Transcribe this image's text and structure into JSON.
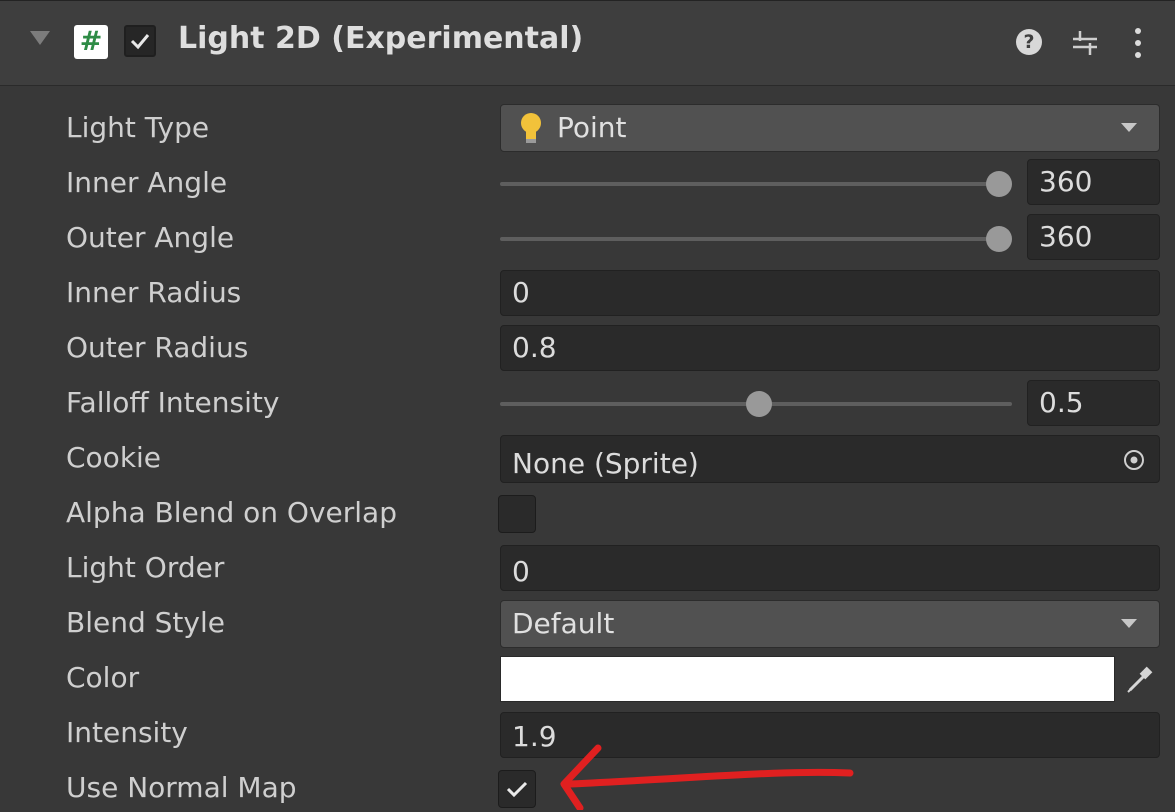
{
  "component": {
    "title": "Light 2D (Experimental)",
    "enabled": true
  },
  "fields": {
    "light_type": {
      "label": "Light Type",
      "value": "Point"
    },
    "inner_angle": {
      "label": "Inner Angle",
      "value": "360",
      "slider_fraction": 1.0
    },
    "outer_angle": {
      "label": "Outer Angle",
      "value": "360",
      "slider_fraction": 1.0
    },
    "inner_radius": {
      "label": "Inner Radius",
      "value": "0"
    },
    "outer_radius": {
      "label": "Outer Radius",
      "value": "0.8"
    },
    "falloff_intensity": {
      "label": "Falloff Intensity",
      "value": "0.5",
      "slider_fraction": 0.5
    },
    "cookie": {
      "label": "Cookie",
      "value": "None (Sprite)"
    },
    "alpha_blend": {
      "label": "Alpha Blend on Overlap",
      "checked": false
    },
    "light_order": {
      "label": "Light Order",
      "value": "0"
    },
    "blend_style": {
      "label": "Blend Style",
      "value": "Default"
    },
    "color": {
      "label": "Color",
      "value": "#FFFFFF"
    },
    "intensity": {
      "label": "Intensity",
      "value": "1.9"
    },
    "use_normal_map": {
      "label": "Use Normal Map",
      "checked": true
    }
  },
  "icons": {
    "foldout": "triangle-down",
    "script": "hash",
    "help": "question-mark",
    "presets": "sliders",
    "menu": "vertical-ellipsis",
    "light_type": "light-bulb",
    "cookie_picker": "object-picker-circle",
    "color_picker": "eyedropper",
    "annotation": "red-arrow"
  },
  "colors": {
    "background": "#383838",
    "header": "#3e3e3e",
    "field": "#2a2a2a",
    "popup": "#515151",
    "annotation": "#e02020"
  }
}
